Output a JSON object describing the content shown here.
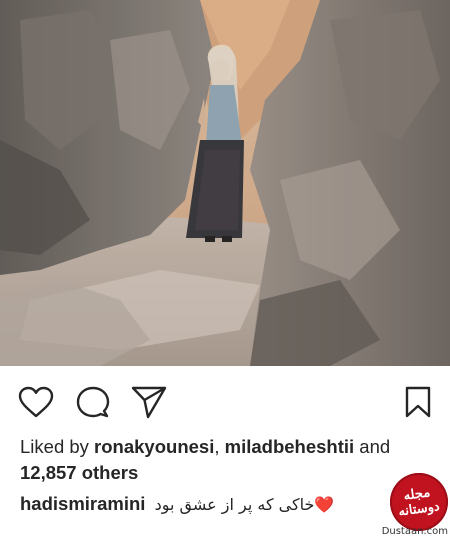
{
  "post": {
    "likes": {
      "prefix": "Liked by ",
      "user1": "ronakyounesi",
      "separator": ", ",
      "user2": "miladbeheshtii",
      "and": " and",
      "others_count": "12,857 others"
    },
    "caption": {
      "username": "hadismiramini",
      "emoji": "❤️",
      "text": "خاکی که پر از عشق بود"
    }
  },
  "watermark": {
    "logo_text": "مجله دوستانه",
    "domain": "Dustaan.com"
  },
  "icons": {
    "like": "heart-outline-icon",
    "comment": "comment-bubble-icon",
    "share": "paper-plane-icon",
    "save": "bookmark-icon"
  }
}
